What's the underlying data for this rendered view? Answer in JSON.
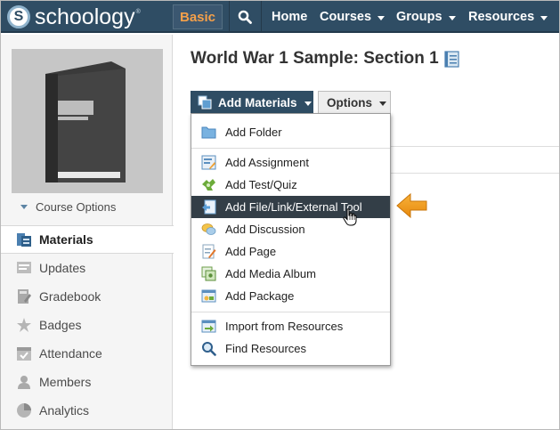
{
  "header": {
    "logo_text": "schoology",
    "logo_letter": "S",
    "logo_tm": "®",
    "plan_badge": "Basic",
    "nav": {
      "home": "Home",
      "courses": "Courses",
      "groups": "Groups",
      "resources": "Resources"
    }
  },
  "sidebar": {
    "course_options": "Course Options",
    "items": [
      {
        "label": "Materials",
        "icon": "materials-icon",
        "active": true
      },
      {
        "label": "Updates",
        "icon": "updates-icon"
      },
      {
        "label": "Gradebook",
        "icon": "gradebook-icon"
      },
      {
        "label": "Badges",
        "icon": "badges-icon"
      },
      {
        "label": "Attendance",
        "icon": "attendance-icon"
      },
      {
        "label": "Members",
        "icon": "members-icon"
      },
      {
        "label": "Analytics",
        "icon": "analytics-icon"
      }
    ]
  },
  "main": {
    "title": "World War 1 Sample: Section 1",
    "add_materials": "Add Materials",
    "options": "Options"
  },
  "menu": {
    "items": [
      {
        "label": "Add Folder",
        "icon": "folder-icon"
      },
      {
        "label": "Add Assignment",
        "icon": "assignment-icon"
      },
      {
        "label": "Add Test/Quiz",
        "icon": "quiz-icon"
      },
      {
        "label": "Add File/Link/External Tool",
        "icon": "file-link-icon",
        "highlighted": true
      },
      {
        "label": "Add Discussion",
        "icon": "discussion-icon"
      },
      {
        "label": "Add Page",
        "icon": "page-icon"
      },
      {
        "label": "Add Media Album",
        "icon": "media-album-icon"
      },
      {
        "label": "Add Package",
        "icon": "package-icon"
      },
      {
        "label": "Import from Resources",
        "icon": "import-icon"
      },
      {
        "label": "Find Resources",
        "icon": "find-icon"
      }
    ]
  },
  "colors": {
    "topbar": "#2f4d64",
    "accent_orange": "#f5a04a",
    "highlight_row": "#333e47",
    "arrow": "#f39c12"
  }
}
